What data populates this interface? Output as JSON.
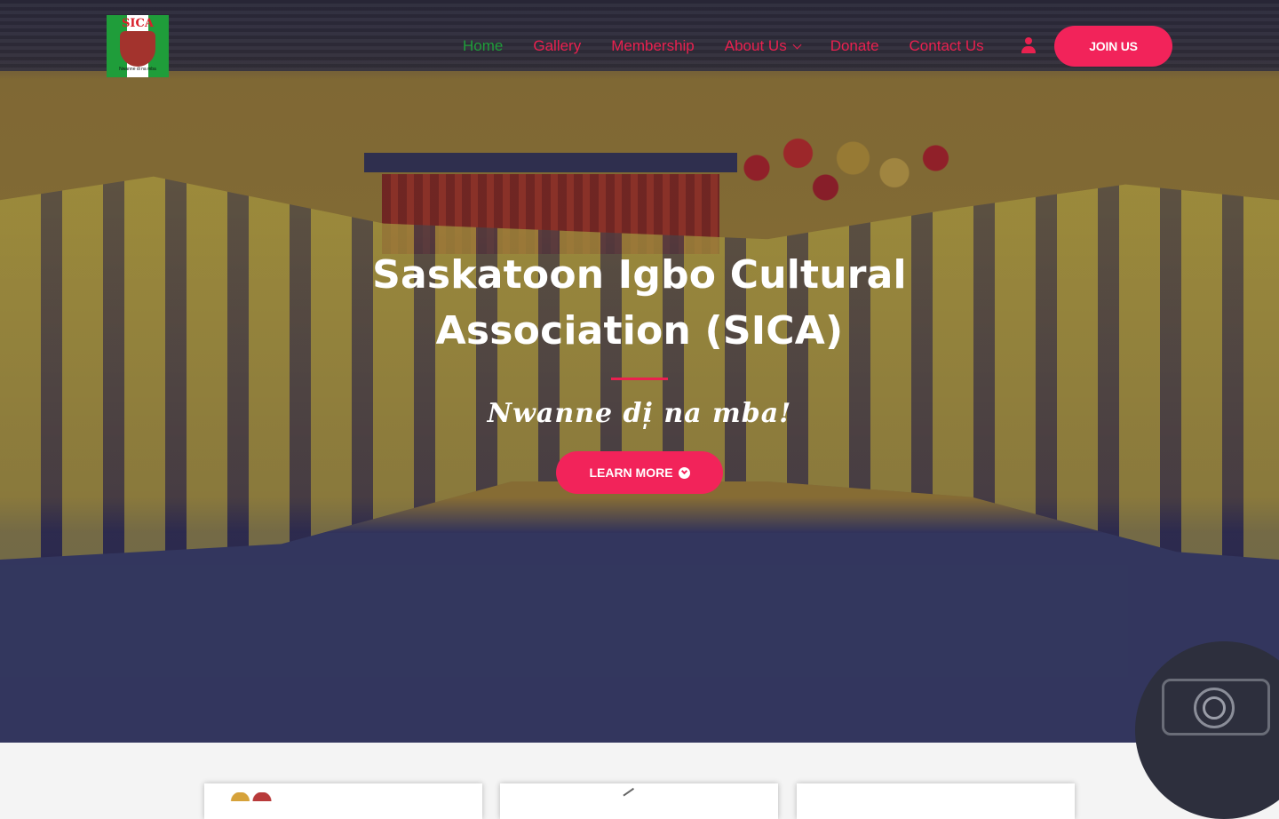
{
  "site": {
    "logo_text": "SICA",
    "logo_motto": "Nwanne di na mba"
  },
  "nav": {
    "items": [
      {
        "label": "Home",
        "active": true
      },
      {
        "label": "Gallery",
        "active": false
      },
      {
        "label": "Membership",
        "active": false
      },
      {
        "label": "About Us",
        "active": false,
        "has_dropdown": true
      },
      {
        "label": "Donate",
        "active": false
      },
      {
        "label": "Contact Us",
        "active": false
      }
    ],
    "account_icon": "user-icon",
    "cta_label": "JOIN US"
  },
  "hero": {
    "title": "Saskatoon Igbo Cultural Association (SICA)",
    "tagline": "Nwanne di̩ na mba!",
    "button_label": "LEARN MORE",
    "button_icon": "arrow-circle-down-icon"
  },
  "colors": {
    "accent": "#f2235a",
    "nav_link": "#e9214f",
    "nav_active": "#1f9d3a",
    "hero_text": "#ffffff",
    "section_bg": "#f4f4f4"
  },
  "cards": [
    {
      "name": "card-1"
    },
    {
      "name": "card-2"
    },
    {
      "name": "card-3"
    }
  ]
}
